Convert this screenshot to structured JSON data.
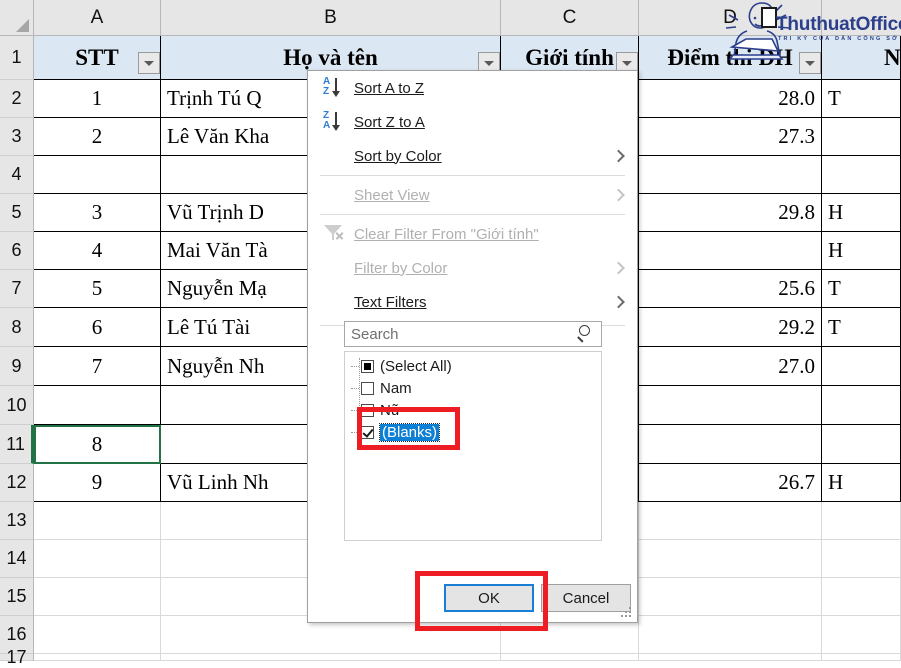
{
  "app": {
    "title": "Excel Worksheet — AutoFilter dropdown",
    "watermark": {
      "brand": "ThuthuatOffice",
      "tagline": "TRI KỶ CỦA DÂN CÔNG SỞ"
    }
  },
  "grid": {
    "column_letters": [
      "A",
      "B",
      "C",
      "D"
    ],
    "row_numbers": [
      "1",
      "2",
      "3",
      "4",
      "5",
      "6",
      "7",
      "8",
      "9",
      "10",
      "11",
      "12",
      "13",
      "14",
      "15",
      "16",
      "17"
    ],
    "selected_cell": "A11",
    "headers": [
      "STT",
      "Họ và tên",
      "Giới tính",
      "Điểm thi ĐH",
      "N"
    ],
    "rows": [
      {
        "row": "2",
        "stt": "1",
        "name": "Trịnh Tú Q",
        "gender": "",
        "score": "28.0",
        "extra": "T"
      },
      {
        "row": "3",
        "stt": "2",
        "name": "Lê Văn Kha",
        "gender": "",
        "score": "27.3",
        "extra": ""
      },
      {
        "row": "4",
        "stt": "",
        "name": "",
        "gender": "",
        "score": "",
        "extra": ""
      },
      {
        "row": "5",
        "stt": "3",
        "name": "Vũ Trịnh D",
        "gender": "",
        "score": "29.8",
        "extra": "H"
      },
      {
        "row": "6",
        "stt": "4",
        "name": "Mai Văn Tà",
        "gender": "",
        "score": "",
        "extra": "H"
      },
      {
        "row": "7",
        "stt": "5",
        "name": "Nguyễn Mạ",
        "gender": "",
        "score": "25.6",
        "extra": "T"
      },
      {
        "row": "8",
        "stt": "6",
        "name": "Lê Tú Tài",
        "gender": "",
        "score": "29.2",
        "extra": "T"
      },
      {
        "row": "9",
        "stt": "7",
        "name": "Nguyễn Nh",
        "gender": "",
        "score": "27.0",
        "extra": ""
      },
      {
        "row": "10",
        "stt": "",
        "name": "",
        "gender": "",
        "score": "",
        "extra": ""
      },
      {
        "row": "11",
        "stt": "8",
        "name": "",
        "gender": "",
        "score": "",
        "extra": ""
      },
      {
        "row": "12",
        "stt": "9",
        "name": "Vũ Linh Nh",
        "gender": "",
        "score": "26.7",
        "extra": "H"
      },
      {
        "row": "13",
        "stt": "",
        "name": "",
        "gender": "",
        "score": "",
        "extra": ""
      },
      {
        "row": "14",
        "stt": "",
        "name": "",
        "gender": "",
        "score": "",
        "extra": ""
      },
      {
        "row": "15",
        "stt": "",
        "name": "",
        "gender": "",
        "score": "",
        "extra": ""
      },
      {
        "row": "16",
        "stt": "",
        "name": "",
        "gender": "",
        "score": "",
        "extra": ""
      },
      {
        "row": "17",
        "stt": "",
        "name": "",
        "gender": "",
        "score": "",
        "extra": ""
      }
    ]
  },
  "dropdown": {
    "menu_items": [
      {
        "label": "Sort A to Z",
        "icon": "sort-az-icon",
        "disabled": false,
        "submenu": false
      },
      {
        "label": "Sort Z to A",
        "icon": "sort-za-icon",
        "disabled": false,
        "submenu": false
      },
      {
        "label": "Sort by Color",
        "icon": "",
        "disabled": false,
        "submenu": true
      },
      {
        "label": "Sheet View",
        "icon": "",
        "disabled": true,
        "submenu": true
      },
      {
        "label": "Clear Filter From \"Giới tính\"",
        "icon": "clear-filter-icon",
        "disabled": true,
        "submenu": false
      },
      {
        "label": "Filter by Color",
        "icon": "",
        "disabled": true,
        "submenu": true
      },
      {
        "label": "Text Filters",
        "icon": "",
        "disabled": false,
        "submenu": true
      }
    ],
    "search": {
      "value": "",
      "placeholder": "Search"
    },
    "checklist": [
      {
        "label": "(Select All)",
        "state": "indeterminate",
        "selected": false
      },
      {
        "label": "Nam",
        "state": "unchecked",
        "selected": false
      },
      {
        "label": "Nữ",
        "state": "unchecked",
        "selected": false
      },
      {
        "label": "(Blanks)",
        "state": "checked",
        "selected": true
      }
    ],
    "buttons": {
      "ok": "OK",
      "cancel": "Cancel"
    }
  },
  "colors": {
    "header_fill": "#dbe7f3",
    "annotation_red": "#ee1c23",
    "selection_green": "#217346",
    "highlight_blue": "#0d7fd4",
    "brand_blue": "#2b3f8c"
  }
}
